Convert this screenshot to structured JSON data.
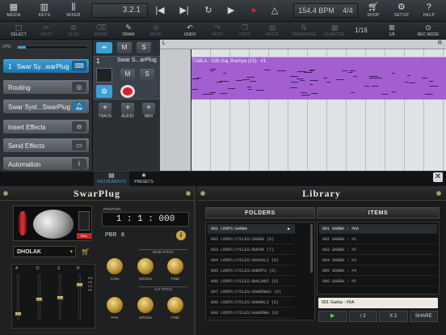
{
  "topbar": {
    "media": "MEDIA",
    "keys": "KEYS",
    "mixer": "MIXER",
    "position": "3.2.1",
    "tempo": "154.4 BPM",
    "signature": "4/4",
    "shop": "SHOP",
    "setup": "SETUP",
    "help": "HELP"
  },
  "toolbar": {
    "select": "SELECT",
    "split": "SPLIT",
    "glue": "GLUE",
    "erase": "ERASE",
    "draw": "DRAW",
    "mute": "MUTE",
    "undo": "UNDO",
    "redo": "REDO",
    "copy": "COPY",
    "paste": "PASTE",
    "transpose": "TRANSPOSE",
    "quantize": "QUANTIZE",
    "quantize_value": "1/16",
    "snap_label": "1/8",
    "rec_mode": "REC MODE"
  },
  "left_panel": {
    "cpu_label": "CPU",
    "cpu_level": 0.12,
    "instrument": "Swar Sy...warPlug",
    "instrument_number": "1",
    "routing": "Routing",
    "plugin_slot": "Swar Syst...SwarPlug",
    "insert_effects": "Insert Effects",
    "send_effects": "Send Effects",
    "automation": "Automation"
  },
  "track": {
    "number": "1",
    "name": "Swar S...arPlug",
    "mute": "M",
    "solo": "S",
    "add_track": "TRACK",
    "add_audio": "AUDIO",
    "add_midi": "MIDI"
  },
  "arrange": {
    "clip_title": "TABLA : 028 Gaj Jhampa (15) : #1",
    "left_marker": "L",
    "right_marker": "R"
  },
  "panel_tabs": {
    "instruments": "INSTRUMENTS",
    "presets": "PRESETS"
  },
  "swarplug": {
    "title": "SwarPlug",
    "instrument": "DHOLAK",
    "position_label": "POSITION",
    "position": "1 : 1 : 000",
    "pbr_label": "PBR",
    "pbr_value": "8",
    "main_pitch": "MAIN PITCH",
    "alt_pitch": "ALT PITCH",
    "gain": "GAIN",
    "gross": "GROSS",
    "fine": "FINE",
    "pan": "PAN",
    "gross2": "GROSS",
    "fine2": "FINE",
    "adsr": [
      "A",
      "D",
      "S",
      "R"
    ],
    "envelope": "ENVELOPE",
    "pnc": "PNC"
  },
  "library": {
    "title": "Library",
    "folders_header": "FOLDERS",
    "items_header": "ITEMS",
    "folders": [
      "001 LOOPS:GARBA",
      "002 LOOPS:CYCLES:DADRA (6)",
      "003 LOOPS:CYCLES:RUPAK (7)",
      "004 LOOPS:CYCLES:GAHVALI (6)",
      "005 LOOPS:CYCLES:KHEMTA (6)",
      "006 LOOPS:CYCLES:BHAJANI (8)",
      "007 LOOPS:CYCLES:KAHERWA2 (8)",
      "008 LOOPS:CYCLES:DHUMALI (8)",
      "009 LOOPS:CYCLES:KAHERWA (8)"
    ],
    "items": [
      "001 GARBA : #6A",
      "002 GARBA : #1",
      "003 GARBA : #2",
      "004 GARBA : #3",
      "005 GARBA : #4",
      "006 GARBA : #5"
    ],
    "selected_item": "001 Garba : #6A",
    "play": "▶",
    "half": "/ 2",
    "double": "X 2",
    "share": "SHARE"
  },
  "colors": {
    "clip": "#a35fd0",
    "accent_blue": "#3aa0d8",
    "gold": "#c8a443",
    "record": "#d4232f"
  }
}
